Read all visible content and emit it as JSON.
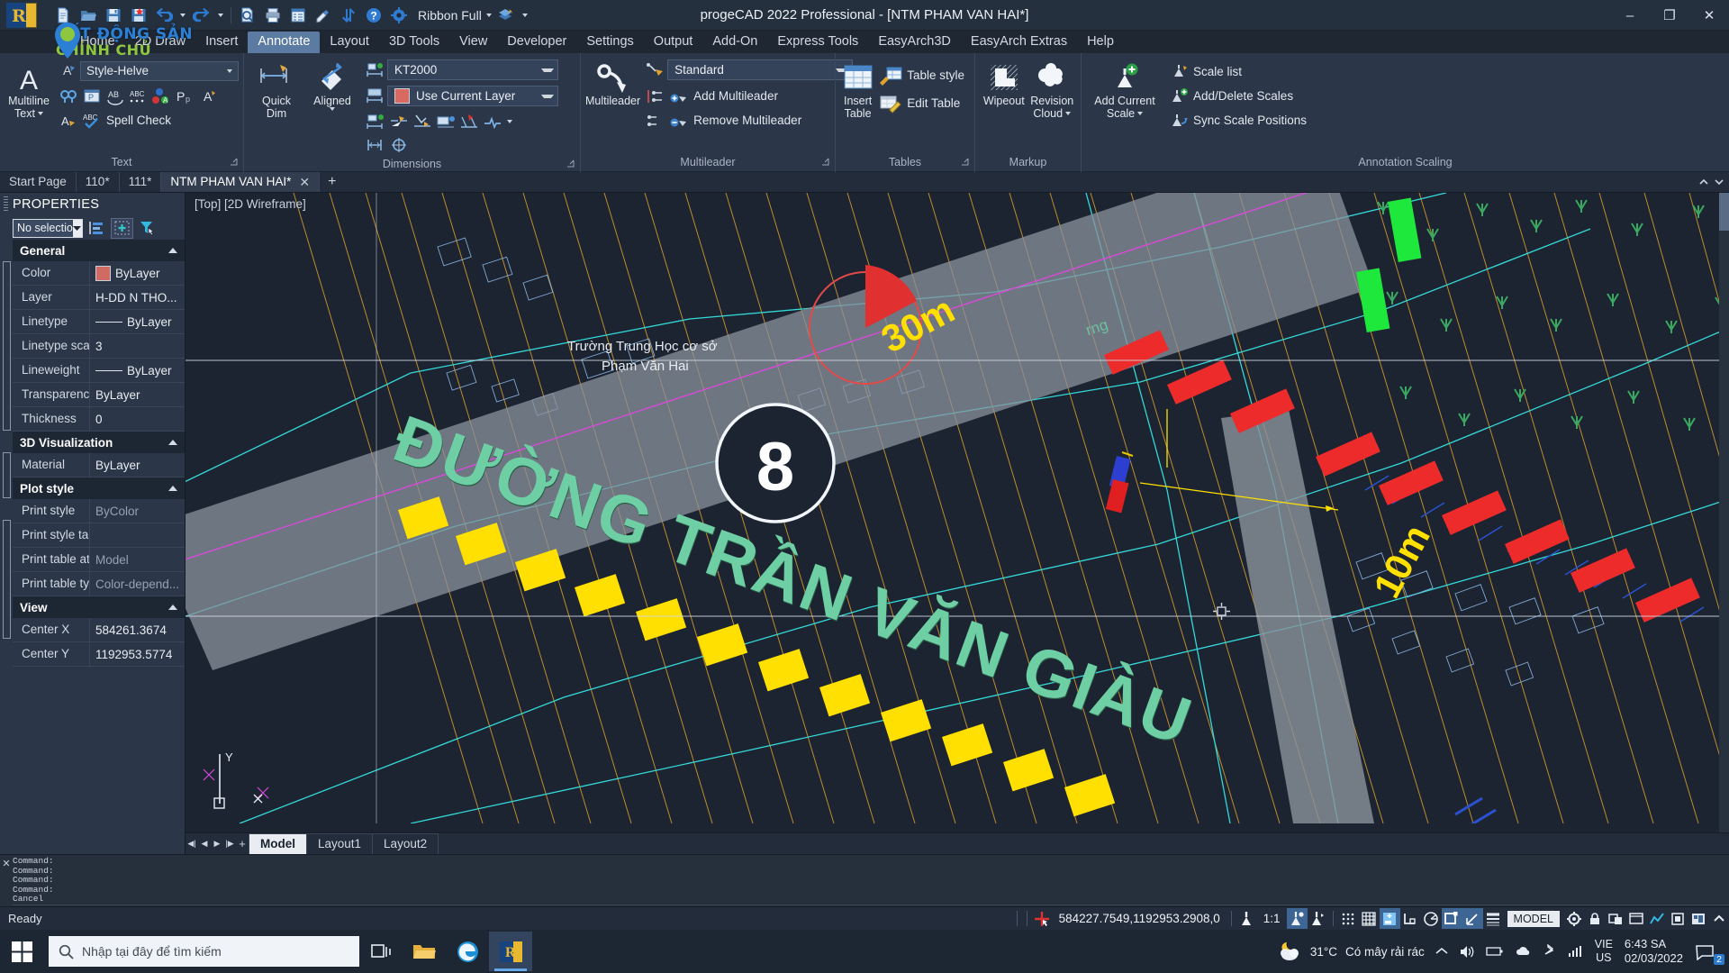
{
  "window": {
    "title": "progeCAD 2022 Professional - [NTM PHAM VAN HAI*]",
    "minimize": "–",
    "maximize": "❐",
    "close": "✕",
    "ribbon_mode": "Ribbon Full"
  },
  "quick_access": [
    {
      "name": "new-file-icon",
      "tip": "New"
    },
    {
      "name": "open-folder-icon",
      "tip": "Open"
    },
    {
      "name": "save-icon",
      "tip": "Save"
    },
    {
      "name": "save-as-icon",
      "tip": "Save As"
    },
    {
      "name": "undo-icon",
      "tip": "Undo"
    },
    {
      "name": "undo-dropdown-icon",
      "tip": "Undo history"
    },
    {
      "name": "redo-icon",
      "tip": "Redo"
    },
    {
      "name": "redo-dropdown-icon",
      "tip": "Redo history"
    },
    {
      "name": "print-preview-icon",
      "tip": "Print Preview"
    },
    {
      "name": "print-icon",
      "tip": "Print"
    },
    {
      "name": "properties-icon",
      "tip": "Properties"
    },
    {
      "name": "match-properties-icon",
      "tip": "Match Properties"
    },
    {
      "name": "sync-icon",
      "tip": "Sync"
    },
    {
      "name": "help-icon",
      "tip": "Help"
    },
    {
      "name": "settings-gear-icon",
      "tip": "Settings"
    }
  ],
  "watermark": {
    "line1": "BẤT ĐỘNG SẢN",
    "line2": "CHÍNH CHỦ"
  },
  "ribbon_tabs": [
    {
      "label": "Home",
      "active": false
    },
    {
      "label": "2D Draw",
      "active": false
    },
    {
      "label": "Insert",
      "active": false
    },
    {
      "label": "Annotate",
      "active": true
    },
    {
      "label": "Layout",
      "active": false
    },
    {
      "label": "3D Tools",
      "active": false
    },
    {
      "label": "View",
      "active": false
    },
    {
      "label": "Developer",
      "active": false
    },
    {
      "label": "Settings",
      "active": false
    },
    {
      "label": "Output",
      "active": false
    },
    {
      "label": "Add-On",
      "active": false
    },
    {
      "label": "Express Tools",
      "active": false
    },
    {
      "label": "EasyArch3D",
      "active": false
    },
    {
      "label": "EasyArch Extras",
      "active": false
    },
    {
      "label": "Help",
      "active": false
    }
  ],
  "ribbon": {
    "text_panel": {
      "title": "Text",
      "big_button": "Multiline\nText",
      "big_button_label1": "Multiline",
      "big_button_label2": "Text",
      "style_value": "Style-Helve",
      "spell_check": "Spell Check"
    },
    "dimensions_panel": {
      "title": "Dimensions",
      "quick_dim_l1": "Quick",
      "quick_dim_l2": "Dim",
      "aligned": "Aligned",
      "dim_style": "KT2000",
      "layer_value": "Use Current Layer"
    },
    "multileader_panel": {
      "title": "Multileader",
      "big_button": "Multileader",
      "style_value": "Standard",
      "add_multileader": "Add Multileader",
      "remove_multileader": "Remove Multileader"
    },
    "tables_panel": {
      "title": "Tables",
      "insert_table_l1": "Insert",
      "insert_table_l2": "Table",
      "table_style": "Table style",
      "edit_table": "Edit Table"
    },
    "markup_panel": {
      "title": "Markup",
      "wipeout": "Wipeout",
      "revision_cloud_l1": "Revision",
      "revision_cloud_l2": "Cloud"
    },
    "annotation_scaling_panel": {
      "title": "Annotation Scaling",
      "add_current_scale_l1": "Add Current",
      "add_current_scale_l2": "Scale",
      "scale_list": "Scale list",
      "add_delete_scales": "Add/Delete Scales",
      "sync_scale_positions": "Sync Scale Positions"
    }
  },
  "document_tabs": [
    {
      "label": "Start Page",
      "active": false,
      "closable": false
    },
    {
      "label": "110*",
      "active": false,
      "closable": false
    },
    {
      "label": "111*",
      "active": false,
      "closable": false
    },
    {
      "label": "NTM PHAM VAN HAI*",
      "active": true,
      "closable": true
    }
  ],
  "document_tab_add": "+",
  "properties": {
    "title": "PROPERTIES",
    "selection": "No selectio",
    "toolbar_icons": [
      "quick-select-icon",
      "add-selection-icon",
      "filter-selection-icon"
    ],
    "groups": [
      {
        "name": "General",
        "rows": [
          {
            "label": "Color",
            "value": "ByLayer",
            "swatch": "#d06a62"
          },
          {
            "label": "Layer",
            "value": "H-DD N THO..."
          },
          {
            "label": "Linetype",
            "value": "ByLayer",
            "line": true
          },
          {
            "label": "Linetype scale",
            "value": "3"
          },
          {
            "label": "Lineweight",
            "value": "ByLayer",
            "line": true
          },
          {
            "label": "Transparency",
            "value": "ByLayer"
          },
          {
            "label": "Thickness",
            "value": "0"
          }
        ]
      },
      {
        "name": "3D Visualization",
        "rows": [
          {
            "label": "Material",
            "value": "ByLayer"
          }
        ]
      },
      {
        "name": "Plot style",
        "rows": [
          {
            "label": "Print style",
            "value": "ByColor",
            "dim": true
          },
          {
            "label": "Print style table",
            "value": ""
          },
          {
            "label": "Print table att...",
            "value": "Model",
            "dim": true
          },
          {
            "label": "Print table type",
            "value": "Color-depend...",
            "dim": true
          }
        ]
      },
      {
        "name": "View",
        "rows": [
          {
            "label": "Center X",
            "value": "584261.3674"
          },
          {
            "label": "Center Y",
            "value": "1192953.5774"
          }
        ]
      }
    ]
  },
  "canvas": {
    "viewport_label": "[Top] [2D Wireframe]",
    "ucs_x": "X",
    "ucs_y": "Y",
    "annotations": {
      "node_number": "8",
      "school_line1": "Trường Trung Học cơ sở",
      "school_line2": "Phạm Văn Hai",
      "street_name": "ĐƯỜNG TRẦN VĂN GIÀU",
      "width_label_1": "30m",
      "width_label_2": "10m",
      "hidden_label": "rng"
    },
    "colors": {
      "background": "#1b2430",
      "street_text": "#6ecfa5",
      "yellow": "#ffe000",
      "red": "#ee2b2b",
      "green": "#1ee83c",
      "cyan": "#35d8d8",
      "magenta": "#d94ad9",
      "gray_road": "#8b929c",
      "orange": "#d9a23c",
      "blue": "#2a52d0"
    },
    "model_tabs": [
      {
        "label": "Model",
        "active": true
      },
      {
        "label": "Layout1",
        "active": false
      },
      {
        "label": "Layout2",
        "active": false
      }
    ],
    "nav_buttons": [
      "first-layout-icon",
      "prev-layout-icon",
      "next-layout-icon",
      "last-layout-icon",
      "new-layout-icon"
    ]
  },
  "command_window": {
    "lines": [
      "Command:",
      "Command:",
      "Command:",
      "Command:",
      "Cancel"
    ],
    "prompt": "Command:"
  },
  "status_bar": {
    "ready": "Ready",
    "coordinates": "584227.7549,1192953.2908,0",
    "scale": "1:1",
    "model_paper": "MODEL",
    "icons": [
      {
        "name": "crosshair-icon",
        "on": false
      },
      {
        "name": "annotation-icon",
        "on": false
      },
      {
        "name": "annotation-visibility-icon",
        "on": true
      },
      {
        "name": "annotation-autoscale-icon",
        "on": false
      },
      {
        "name": "snap-dots-icon",
        "on": false
      },
      {
        "name": "grid-rect-icon",
        "on": false
      },
      {
        "name": "grid-display-icon",
        "on": false
      },
      {
        "name": "snap-mode-icon",
        "on": true
      },
      {
        "name": "ortho-icon",
        "on": false
      },
      {
        "name": "polar-tracking-icon",
        "on": false
      },
      {
        "name": "object-snap-icon",
        "on": true
      },
      {
        "name": "object-snap-tracking-icon",
        "on": true
      },
      {
        "name": "lineweight-icon",
        "on": false
      }
    ],
    "right_icons": [
      {
        "name": "settings-gear-icon"
      },
      {
        "name": "lock-icon"
      },
      {
        "name": "isolate-objects-icon"
      },
      {
        "name": "clean-screen-icon"
      },
      {
        "name": "performance-icon"
      },
      {
        "name": "hardware-accel-icon"
      },
      {
        "name": "workspace-icon"
      },
      {
        "name": "expand-icon"
      }
    ]
  },
  "taskbar": {
    "start_icon": "windows-start-icon",
    "search_placeholder": "Nhập tại đây để tìm kiếm",
    "search_icon": "search-icon",
    "apps": [
      {
        "name": "task-view-icon",
        "active": false
      },
      {
        "name": "file-explorer-icon",
        "active": false
      },
      {
        "name": "microsoft-edge-icon",
        "active": false
      },
      {
        "name": "progecad-icon",
        "active": true
      }
    ],
    "weather_temp": "31°C",
    "weather_desc": "Có mây rải rác",
    "language_line1": "VIE",
    "language_line2": "US",
    "time": "6:43 SA",
    "date": "02/03/2022",
    "notification_count": "2"
  }
}
